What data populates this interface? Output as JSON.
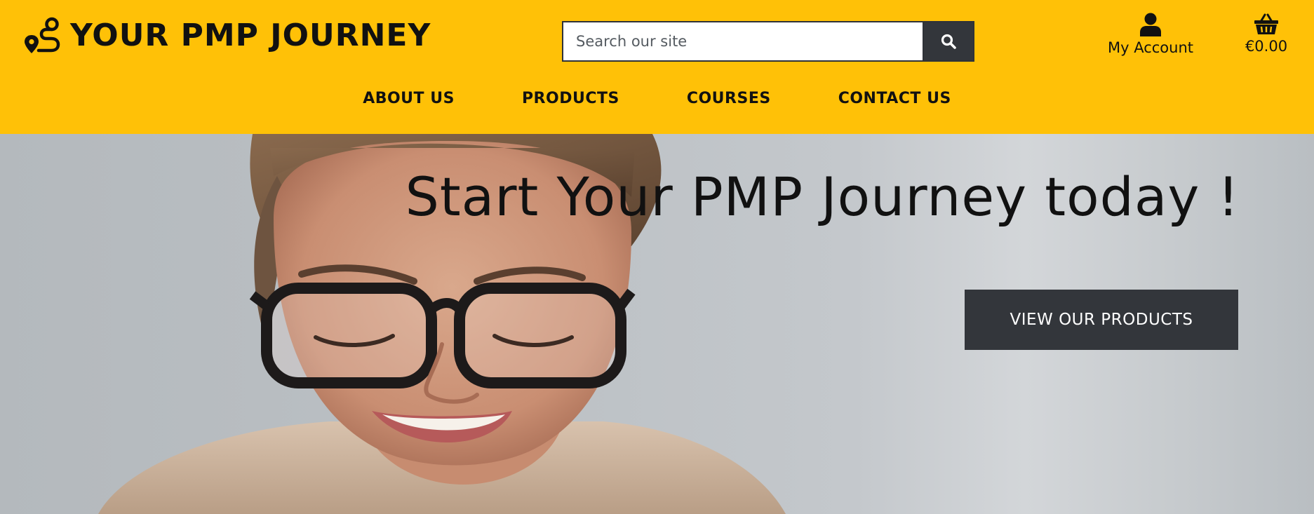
{
  "brand": {
    "name": "YOUR PMP JOURNEY",
    "icon": "route-icon"
  },
  "search": {
    "placeholder": "Search our site",
    "value": "",
    "icon": "search-icon"
  },
  "account": {
    "label": "My Account",
    "icon": "user-icon"
  },
  "cart": {
    "total": "€0.00",
    "icon": "basket-icon"
  },
  "nav": {
    "items": [
      {
        "label": "ABOUT US"
      },
      {
        "label": "PRODUCTS"
      },
      {
        "label": "COURSES"
      },
      {
        "label": "CONTACT US"
      }
    ]
  },
  "hero": {
    "title": "Start Your PMP Journey today !",
    "cta_label": "VIEW OUR PRODUCTS"
  },
  "colors": {
    "header_bg": "#FFC107",
    "dark_button": "#33363B",
    "text": "#111111"
  }
}
